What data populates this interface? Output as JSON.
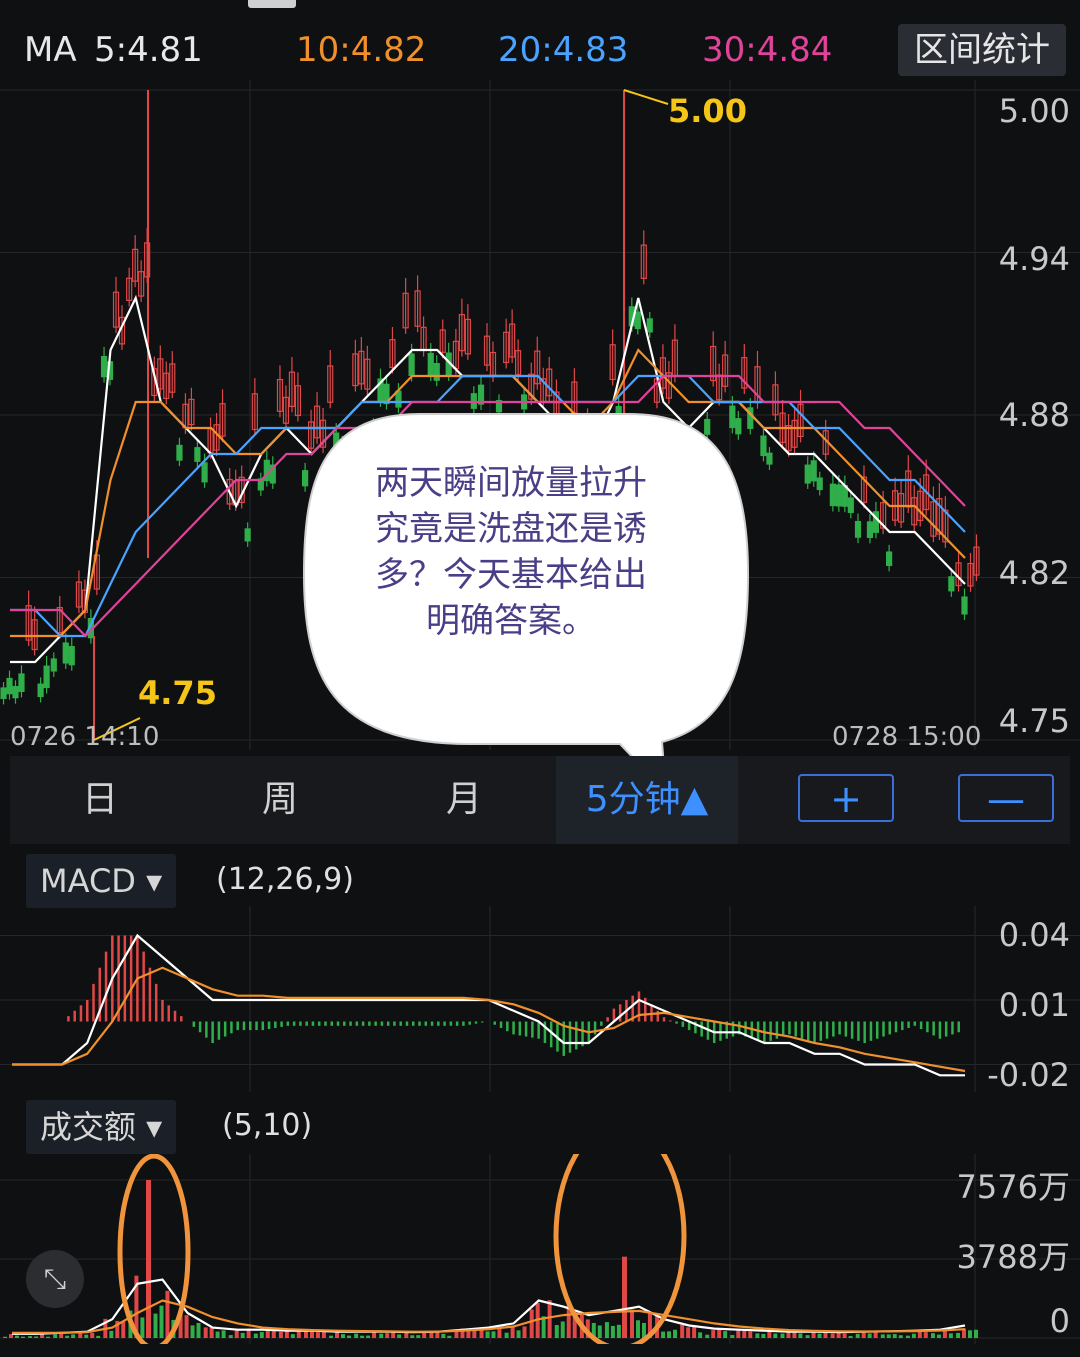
{
  "ma_header": {
    "ma_label": "MA",
    "ma5": "5:4.81",
    "ma10": "10:4.82",
    "ma20": "20:4.83",
    "ma30": "30:4.84",
    "stats_button": "区间统计"
  },
  "colors": {
    "ma5": "#ffffff",
    "ma10": "#f0902c",
    "ma20": "#4aa3ff",
    "ma30": "#e0449a",
    "up": "#e04848",
    "down": "#2fae4a",
    "accent": "#3e8fff",
    "annotation": "#f5c518",
    "circle": "#f0953c",
    "bubble_text": "#4a3f86"
  },
  "price_axis": [
    "5.00",
    "4.94",
    "4.88",
    "4.82",
    "4.75"
  ],
  "price_annotations": {
    "high": "5.00",
    "low": "4.75"
  },
  "dates": {
    "start": "0726  14:10",
    "end": "0728  15:00"
  },
  "speech_bubble": "两天瞬间放量拉升究竟是洗盘还是诱多？今天基本给出明确答案。",
  "period_tabs": [
    "日",
    "周",
    "月",
    "5分钟▲"
  ],
  "zoom": {
    "plus": "+",
    "minus": "—"
  },
  "macd": {
    "selector": "MACD ▾",
    "params": "(12,26,9)",
    "axis": [
      "0.04",
      "0.01",
      "-0.02"
    ]
  },
  "volume": {
    "selector": "成交额 ▾",
    "params": "(5,10)",
    "axis": [
      "7576万",
      "3788万",
      "0"
    ]
  },
  "icons": {
    "expand": "expand-icon"
  },
  "chart_data": [
    {
      "type": "candlestick",
      "title": "",
      "ylim": [
        4.75,
        5.0
      ],
      "x_range": [
        "0726 14:10",
        "0728 15:00"
      ],
      "grid": true,
      "annotations": [
        {
          "label": "5.00",
          "value": 5.0
        },
        {
          "label": "4.75",
          "value": 4.75
        }
      ],
      "series": [
        {
          "name": "MA5",
          "values": [
            4.78,
            4.78,
            4.79,
            4.8,
            4.9,
            4.92,
            4.88,
            4.87,
            4.86,
            4.84,
            4.86,
            4.87,
            4.86,
            4.87,
            4.88,
            4.89,
            4.9,
            4.9,
            4.89,
            4.89,
            4.89,
            4.88,
            4.87,
            4.86,
            4.88,
            4.92,
            4.88,
            4.87,
            4.88,
            4.88,
            4.87,
            4.86,
            4.86,
            4.85,
            4.84,
            4.83,
            4.83,
            4.82,
            4.81
          ]
        },
        {
          "name": "MA10",
          "values": [
            4.79,
            4.79,
            4.79,
            4.8,
            4.85,
            4.88,
            4.88,
            4.87,
            4.87,
            4.86,
            4.86,
            4.87,
            4.87,
            4.87,
            4.88,
            4.88,
            4.89,
            4.89,
            4.89,
            4.89,
            4.89,
            4.88,
            4.88,
            4.87,
            4.88,
            4.9,
            4.89,
            4.88,
            4.88,
            4.88,
            4.87,
            4.87,
            4.87,
            4.86,
            4.85,
            4.84,
            4.84,
            4.83,
            4.82
          ]
        },
        {
          "name": "MA20",
          "values": [
            4.8,
            4.8,
            4.79,
            4.79,
            4.81,
            4.83,
            4.84,
            4.85,
            4.86,
            4.86,
            4.87,
            4.87,
            4.87,
            4.87,
            4.88,
            4.88,
            4.88,
            4.88,
            4.89,
            4.89,
            4.89,
            4.89,
            4.88,
            4.88,
            4.88,
            4.89,
            4.89,
            4.89,
            4.88,
            4.88,
            4.88,
            4.88,
            4.87,
            4.87,
            4.86,
            4.85,
            4.85,
            4.84,
            4.83
          ]
        },
        {
          "name": "MA30",
          "values": [
            4.8,
            4.8,
            4.8,
            4.79,
            4.8,
            4.81,
            4.82,
            4.83,
            4.84,
            4.85,
            4.85,
            4.86,
            4.86,
            4.87,
            4.87,
            4.87,
            4.88,
            4.88,
            4.88,
            4.88,
            4.88,
            4.88,
            4.88,
            4.88,
            4.88,
            4.88,
            4.89,
            4.89,
            4.89,
            4.89,
            4.88,
            4.88,
            4.88,
            4.88,
            4.87,
            4.87,
            4.86,
            4.85,
            4.84
          ]
        }
      ]
    },
    {
      "type": "macd",
      "params": "(12,26,9)",
      "ylim": [
        -0.03,
        0.05
      ],
      "series": [
        {
          "name": "DIF",
          "values": [
            -0.02,
            -0.02,
            -0.02,
            -0.01,
            0.02,
            0.04,
            0.03,
            0.02,
            0.01,
            0.01,
            0.01,
            0.01,
            0.01,
            0.01,
            0.01,
            0.01,
            0.01,
            0.01,
            0.01,
            0.01,
            0.005,
            0.0,
            -0.01,
            -0.01,
            0.0,
            0.01,
            0.005,
            0.0,
            -0.005,
            -0.005,
            -0.01,
            -0.01,
            -0.015,
            -0.015,
            -0.02,
            -0.02,
            -0.02,
            -0.025,
            -0.025
          ]
        },
        {
          "name": "DEA",
          "values": [
            -0.02,
            -0.02,
            -0.02,
            -0.015,
            0.0,
            0.02,
            0.025,
            0.02,
            0.015,
            0.012,
            0.012,
            0.011,
            0.011,
            0.011,
            0.011,
            0.011,
            0.011,
            0.011,
            0.011,
            0.01,
            0.008,
            0.004,
            -0.002,
            -0.005,
            -0.003,
            0.003,
            0.004,
            0.002,
            0.0,
            -0.002,
            -0.005,
            -0.007,
            -0.01,
            -0.012,
            -0.015,
            -0.017,
            -0.019,
            -0.021,
            -0.023
          ]
        }
      ]
    },
    {
      "type": "bar",
      "title": "成交额",
      "params": "(5,10)",
      "ylim": [
        0,
        7576
      ],
      "unit": "万",
      "series": [
        {
          "name": "MA5",
          "values": [
            200,
            200,
            250,
            300,
            900,
            2600,
            2800,
            1200,
            500,
            400,
            400,
            350,
            350,
            300,
            300,
            300,
            280,
            300,
            400,
            500,
            700,
            1800,
            1500,
            1100,
            1300,
            1500,
            900,
            600,
            450,
            400,
            350,
            300,
            300,
            280,
            300,
            320,
            350,
            400,
            600
          ]
        },
        {
          "name": "MA10",
          "values": [
            250,
            250,
            250,
            280,
            500,
            1200,
            1800,
            1500,
            1000,
            700,
            500,
            420,
            380,
            350,
            330,
            320,
            300,
            300,
            350,
            420,
            550,
            900,
            1100,
            1200,
            1250,
            1300,
            1100,
            900,
            700,
            550,
            450,
            380,
            340,
            320,
            310,
            320,
            330,
            360,
            420
          ]
        }
      ]
    }
  ]
}
